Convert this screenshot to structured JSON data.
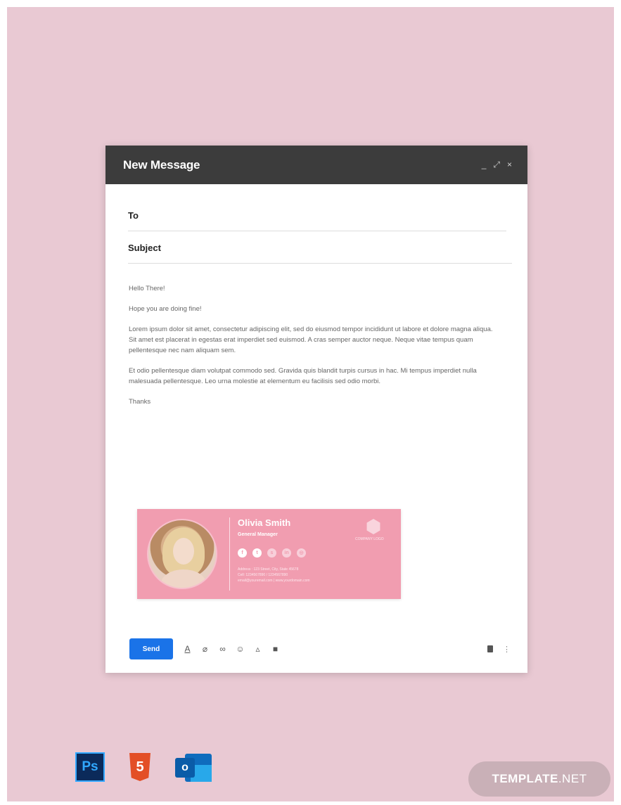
{
  "compose": {
    "title": "New Message",
    "controls": {
      "minimize": "_",
      "expand": "⤢",
      "close": "×"
    },
    "to_label": "To",
    "subject_label": "Subject",
    "body": [
      "Hello There!",
      "Hope you are doing fine!",
      "Lorem ipsum dolor sit amet, consectetur adipiscing elit, sed do eiusmod tempor incididunt ut labore et dolore magna aliqua. Sit amet est placerat in egestas erat imperdiet sed euismod. A cras semper auctor neque. Neque vitae tempus quam pellentesque nec nam aliquam sem.",
      "Et odio pellentesque diam volutpat commodo sed. Gravida quis blandit turpis cursus in hac. Mi tempus imperdiet nulla malesuada pellentesque. Leo urna molestie at elementum eu facilisis sed odio morbi.",
      "Thanks"
    ],
    "send_label": "Send"
  },
  "signature": {
    "name": "Olivia Smith",
    "role": "General Manager",
    "socials": [
      "facebook",
      "twitter",
      "skype",
      "linkedin",
      "instagram"
    ],
    "lines": [
      "Address : 123 Street, City, State 45678",
      "Cell: 1234567890 / 1234567890",
      "email@youremail.com | www.yourdomain.com"
    ],
    "logo_text": "COMPANY LOGO"
  },
  "badges": {
    "photoshop": "Ps",
    "html5": "5",
    "outlook": "o"
  },
  "brand": {
    "template": "TEMPLATE",
    "net": ".NET"
  },
  "colors": {
    "background": "#e9c9d3",
    "header": "#3c3c3c",
    "signature_bg": "#f19db0",
    "send": "#1a73e8"
  }
}
